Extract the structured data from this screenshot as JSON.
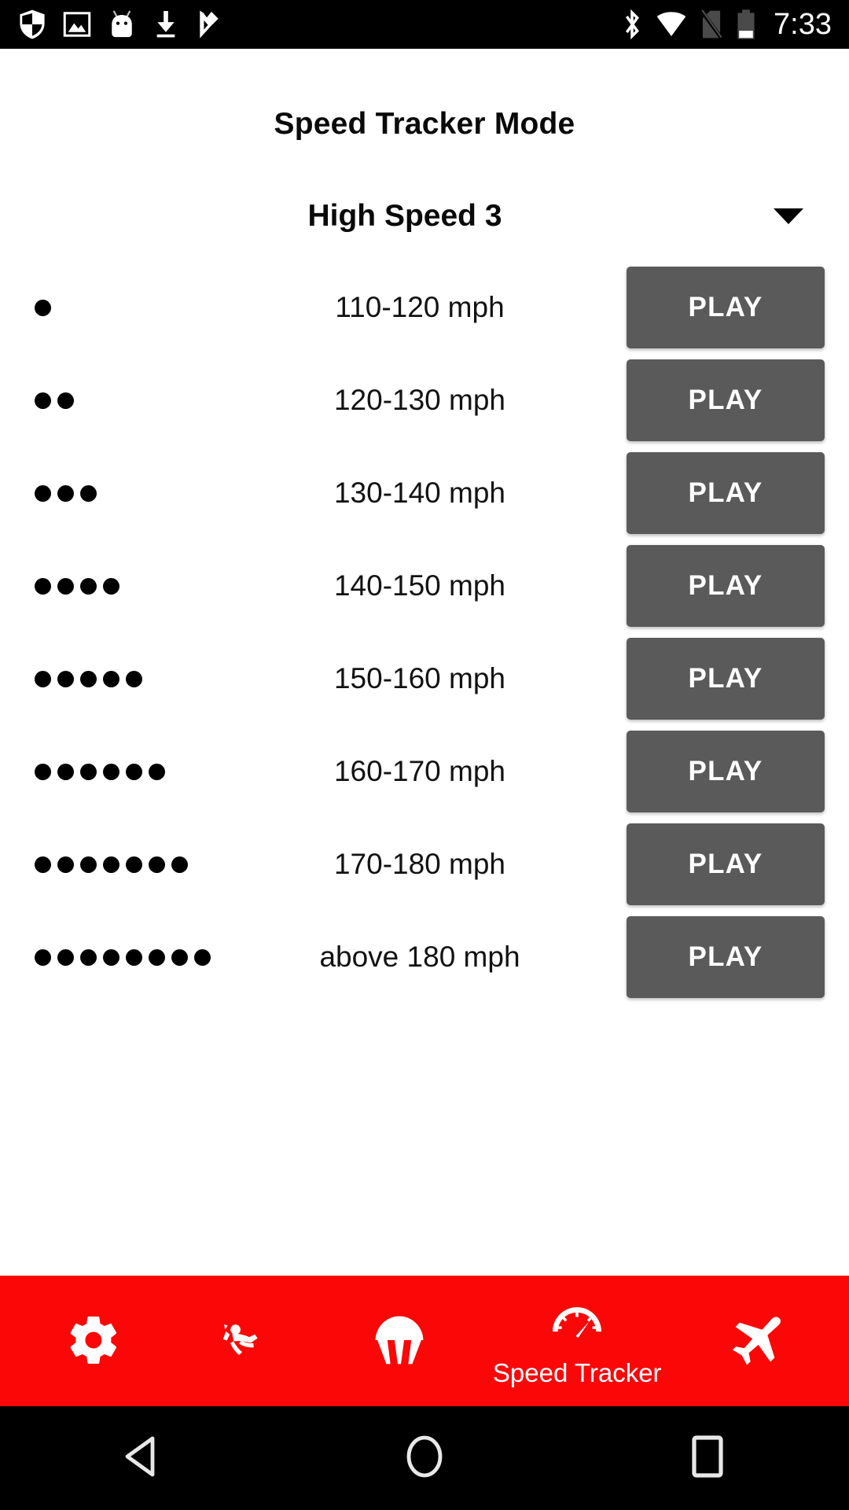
{
  "status_bar": {
    "left_icons": [
      {
        "name": "shield-icon"
      },
      {
        "name": "image-icon"
      },
      {
        "name": "android-icon"
      },
      {
        "name": "download-icon"
      },
      {
        "name": "checkmark-shield-icon"
      }
    ],
    "right_icons": [
      {
        "name": "bluetooth-icon"
      },
      {
        "name": "wifi-icon"
      },
      {
        "name": "no-sim-icon"
      },
      {
        "name": "battery-icon"
      }
    ],
    "time": "7:33"
  },
  "header": {
    "title": "Speed Tracker Mode"
  },
  "mode_selector": {
    "selected": "High Speed 3",
    "caret_icon": "chevron-down-icon"
  },
  "speed_rows": [
    {
      "dots": 1,
      "range": "110-120 mph",
      "play_label": "PLAY"
    },
    {
      "dots": 2,
      "range": "120-130 mph",
      "play_label": "PLAY"
    },
    {
      "dots": 3,
      "range": "130-140 mph",
      "play_label": "PLAY"
    },
    {
      "dots": 4,
      "range": "140-150 mph",
      "play_label": "PLAY"
    },
    {
      "dots": 5,
      "range": "150-160 mph",
      "play_label": "PLAY"
    },
    {
      "dots": 6,
      "range": "160-170 mph",
      "play_label": "PLAY"
    },
    {
      "dots": 7,
      "range": "170-180 mph",
      "play_label": "PLAY"
    },
    {
      "dots": 8,
      "range": "above 180 mph",
      "play_label": "PLAY"
    }
  ],
  "bottom_nav": {
    "background_color": "#fb0707",
    "items": [
      {
        "icon": "gear-icon",
        "label": ""
      },
      {
        "icon": "skydiver-icon",
        "label": ""
      },
      {
        "icon": "parachute-icon",
        "label": ""
      },
      {
        "icon": "speedometer-icon",
        "label": "Speed Tracker"
      },
      {
        "icon": "airplane-icon",
        "label": ""
      }
    ]
  },
  "system_nav": {
    "buttons": [
      {
        "icon": "back-triangle-icon"
      },
      {
        "icon": "home-circle-icon"
      },
      {
        "icon": "recents-square-icon"
      }
    ]
  },
  "colors": {
    "accent_red": "#fb0707",
    "play_button_gray": "#5a5a5a",
    "text_black": "#0a0a0a"
  }
}
